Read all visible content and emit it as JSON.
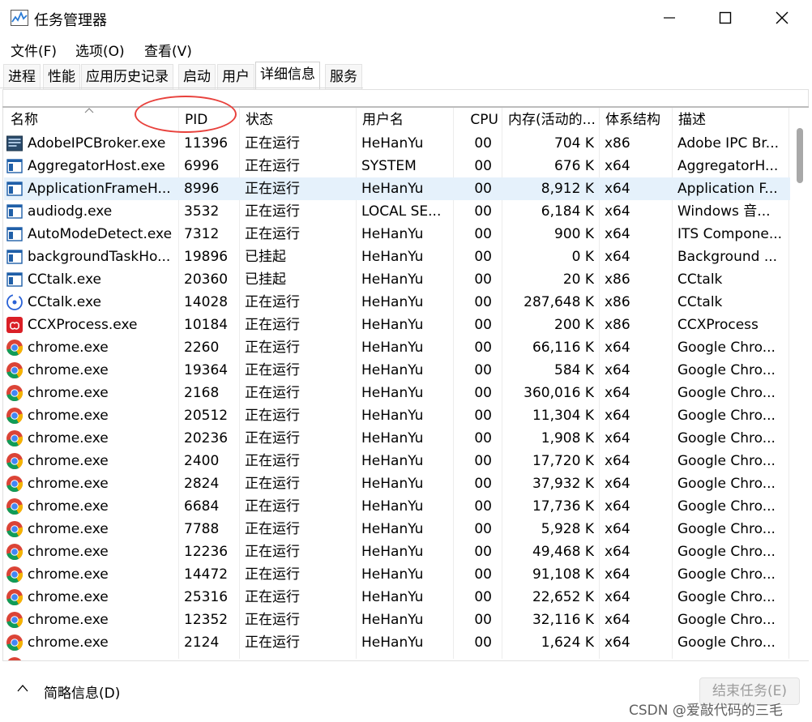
{
  "window": {
    "title": "任务管理器"
  },
  "menu": [
    "文件(F)",
    "选项(O)",
    "查看(V)"
  ],
  "tabs": [
    "进程",
    "性能",
    "应用历史记录",
    "启动",
    "用户",
    "详细信息",
    "服务"
  ],
  "columns": [
    "名称",
    "PID",
    "状态",
    "用户名",
    "CPU",
    "内存(活动的...",
    "体系结构",
    "描述"
  ],
  "rows": [
    {
      "icon": "adobe-broker-icon",
      "name": "AdobeIPCBroker.exe",
      "pid": "11396",
      "status": "正在运行",
      "user": "HeHanYu",
      "cpu": "00",
      "mem": "704 K",
      "arch": "x86",
      "desc": "Adobe IPC Br..."
    },
    {
      "icon": "window-app-icon",
      "name": "AggregatorHost.exe",
      "pid": "6996",
      "status": "正在运行",
      "user": "SYSTEM",
      "cpu": "00",
      "mem": "676 K",
      "arch": "x64",
      "desc": "AggregatorH..."
    },
    {
      "icon": "window-app-icon",
      "name": "ApplicationFrameH...",
      "pid": "8996",
      "status": "正在运行",
      "user": "HeHanYu",
      "cpu": "00",
      "mem": "8,912 K",
      "arch": "x64",
      "desc": "Application F...",
      "selected": true
    },
    {
      "icon": "window-app-icon",
      "name": "audiodg.exe",
      "pid": "3532",
      "status": "正在运行",
      "user": "LOCAL SE...",
      "cpu": "00",
      "mem": "6,184 K",
      "arch": "x64",
      "desc": "Windows 音..."
    },
    {
      "icon": "window-app-icon",
      "name": "AutoModeDetect.exe",
      "pid": "7312",
      "status": "正在运行",
      "user": "HeHanYu",
      "cpu": "00",
      "mem": "900 K",
      "arch": "x64",
      "desc": "ITS Compone..."
    },
    {
      "icon": "window-app-icon",
      "name": "backgroundTaskHo...",
      "pid": "19896",
      "status": "已挂起",
      "user": "HeHanYu",
      "cpu": "00",
      "mem": "0 K",
      "arch": "x64",
      "desc": "Background ..."
    },
    {
      "icon": "window-app-icon",
      "name": "CCtalk.exe",
      "pid": "20360",
      "status": "已挂起",
      "user": "HeHanYu",
      "cpu": "00",
      "mem": "20 K",
      "arch": "x86",
      "desc": "CCtalk"
    },
    {
      "icon": "cctalk-icon",
      "name": "CCtalk.exe",
      "pid": "14028",
      "status": "正在运行",
      "user": "HeHanYu",
      "cpu": "00",
      "mem": "287,648 K",
      "arch": "x86",
      "desc": "CCtalk"
    },
    {
      "icon": "adobe-cc-icon",
      "name": "CCXProcess.exe",
      "pid": "10184",
      "status": "正在运行",
      "user": "HeHanYu",
      "cpu": "00",
      "mem": "200 K",
      "arch": "x86",
      "desc": "CCXProcess"
    },
    {
      "icon": "chrome-icon",
      "name": "chrome.exe",
      "pid": "2260",
      "status": "正在运行",
      "user": "HeHanYu",
      "cpu": "00",
      "mem": "66,116 K",
      "arch": "x64",
      "desc": "Google Chro..."
    },
    {
      "icon": "chrome-icon",
      "name": "chrome.exe",
      "pid": "19364",
      "status": "正在运行",
      "user": "HeHanYu",
      "cpu": "00",
      "mem": "584 K",
      "arch": "x64",
      "desc": "Google Chro..."
    },
    {
      "icon": "chrome-icon",
      "name": "chrome.exe",
      "pid": "2168",
      "status": "正在运行",
      "user": "HeHanYu",
      "cpu": "00",
      "mem": "360,016 K",
      "arch": "x64",
      "desc": "Google Chro..."
    },
    {
      "icon": "chrome-icon",
      "name": "chrome.exe",
      "pid": "20512",
      "status": "正在运行",
      "user": "HeHanYu",
      "cpu": "00",
      "mem": "11,304 K",
      "arch": "x64",
      "desc": "Google Chro..."
    },
    {
      "icon": "chrome-icon",
      "name": "chrome.exe",
      "pid": "20236",
      "status": "正在运行",
      "user": "HeHanYu",
      "cpu": "00",
      "mem": "1,908 K",
      "arch": "x64",
      "desc": "Google Chro..."
    },
    {
      "icon": "chrome-icon",
      "name": "chrome.exe",
      "pid": "2400",
      "status": "正在运行",
      "user": "HeHanYu",
      "cpu": "00",
      "mem": "17,720 K",
      "arch": "x64",
      "desc": "Google Chro..."
    },
    {
      "icon": "chrome-icon",
      "name": "chrome.exe",
      "pid": "2824",
      "status": "正在运行",
      "user": "HeHanYu",
      "cpu": "00",
      "mem": "37,932 K",
      "arch": "x64",
      "desc": "Google Chro..."
    },
    {
      "icon": "chrome-icon",
      "name": "chrome.exe",
      "pid": "6684",
      "status": "正在运行",
      "user": "HeHanYu",
      "cpu": "00",
      "mem": "17,736 K",
      "arch": "x64",
      "desc": "Google Chro..."
    },
    {
      "icon": "chrome-icon",
      "name": "chrome.exe",
      "pid": "7788",
      "status": "正在运行",
      "user": "HeHanYu",
      "cpu": "00",
      "mem": "5,928 K",
      "arch": "x64",
      "desc": "Google Chro..."
    },
    {
      "icon": "chrome-icon",
      "name": "chrome.exe",
      "pid": "12236",
      "status": "正在运行",
      "user": "HeHanYu",
      "cpu": "00",
      "mem": "49,468 K",
      "arch": "x64",
      "desc": "Google Chro..."
    },
    {
      "icon": "chrome-icon",
      "name": "chrome.exe",
      "pid": "14472",
      "status": "正在运行",
      "user": "HeHanYu",
      "cpu": "00",
      "mem": "91,108 K",
      "arch": "x64",
      "desc": "Google Chro..."
    },
    {
      "icon": "chrome-icon",
      "name": "chrome.exe",
      "pid": "25316",
      "status": "正在运行",
      "user": "HeHanYu",
      "cpu": "00",
      "mem": "22,652 K",
      "arch": "x64",
      "desc": "Google Chro..."
    },
    {
      "icon": "chrome-icon",
      "name": "chrome.exe",
      "pid": "12352",
      "status": "正在运行",
      "user": "HeHanYu",
      "cpu": "00",
      "mem": "32,116 K",
      "arch": "x64",
      "desc": "Google Chro..."
    },
    {
      "icon": "chrome-icon",
      "name": "chrome.exe",
      "pid": "2124",
      "status": "正在运行",
      "user": "HeHanYu",
      "cpu": "00",
      "mem": "1,624 K",
      "arch": "x64",
      "desc": "Google Chro..."
    }
  ],
  "footer": {
    "fewer_details": "简略信息(D)",
    "end_task": "结束任务(E)"
  },
  "watermark": "CSDN @爱敲代码的三毛",
  "colors": {
    "selected_row": "#e5f1fb",
    "annotation": "#e8413c",
    "chrome_red": "#db4437",
    "chrome_yellow": "#f4b400",
    "chrome_green": "#0f9d58",
    "chrome_blue": "#4285f4"
  }
}
